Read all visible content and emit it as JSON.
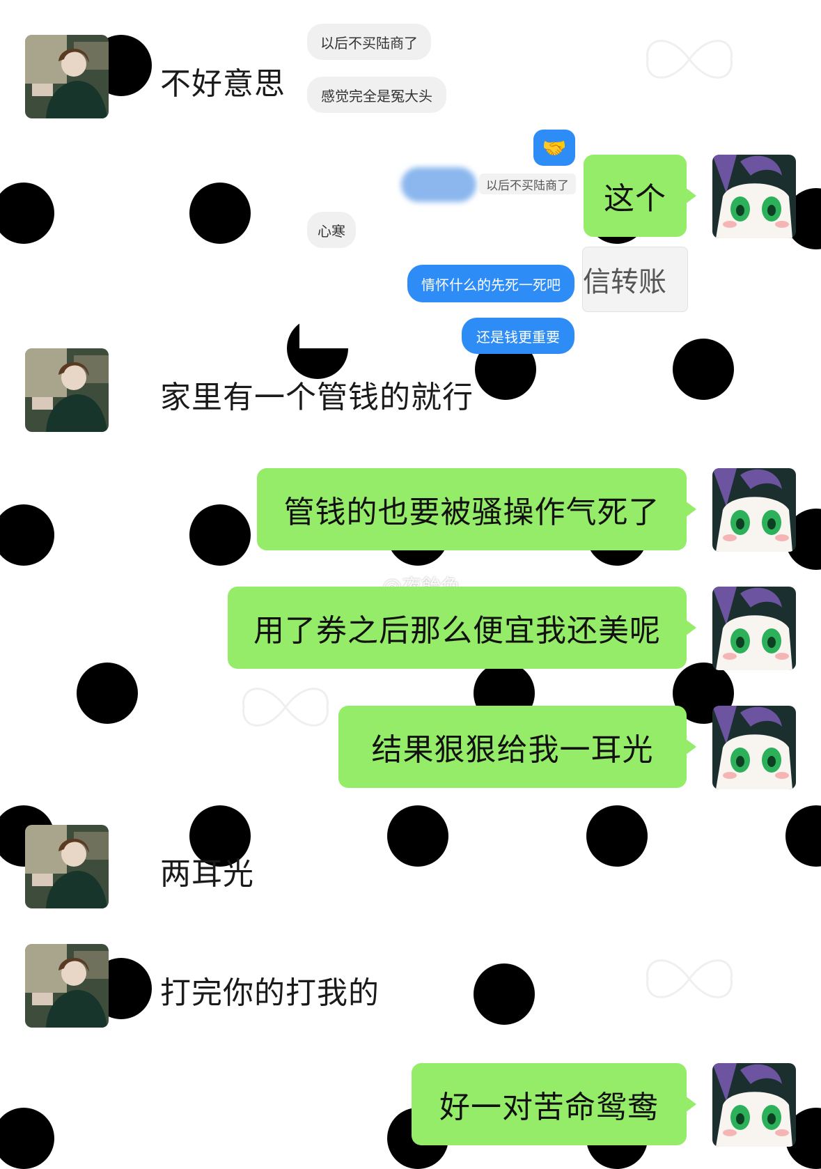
{
  "conversation": {
    "incoming": [
      {
        "text": "不好意思"
      },
      {
        "text": "家里有一个管钱的就行"
      },
      {
        "text": "两耳光"
      },
      {
        "text": "打完你的打我的"
      }
    ],
    "outgoing": [
      {
        "text": "这个"
      },
      {
        "text": "管钱的也要被骚操作气死了"
      },
      {
        "text": "用了券之后那么便宜我还美呢"
      },
      {
        "text": "结果狠狠给我一耳光"
      },
      {
        "text": "好一对苦命鸳鸯"
      }
    ],
    "transfer_card_text": "信转账"
  },
  "embedded_screenshot": {
    "grey_msgs": [
      "以后不买陆商了",
      "感觉完全是冤大头",
      "心寒"
    ],
    "reply_quote": "以后不买陆商了",
    "blue_msgs": [
      "情怀什么的先死一死吧",
      "还是钱更重要"
    ],
    "emoji": "🤝"
  },
  "watermark": {
    "text": "@夜飴色",
    "icon": "weibo-icon"
  },
  "colors": {
    "wechat_green": "#95ec69",
    "qq_blue": "#2e8cf6",
    "dot_black": "#000000",
    "bubble_grey": "#f0f0f0"
  }
}
